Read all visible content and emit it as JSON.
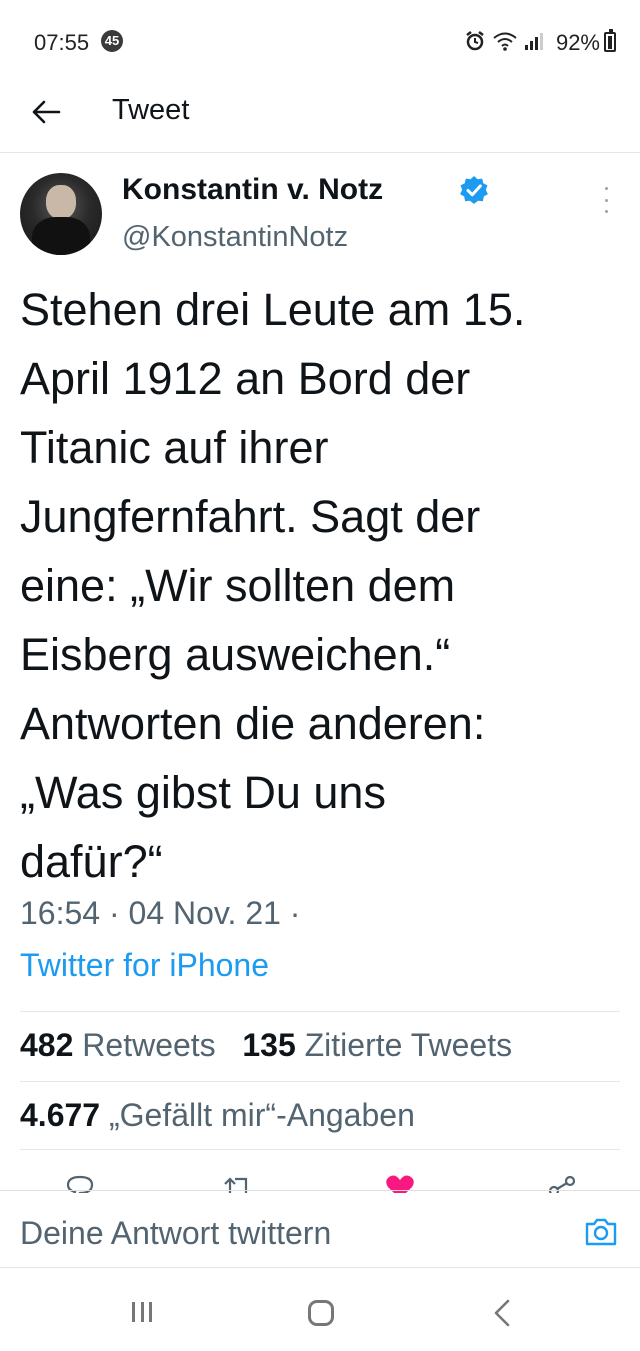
{
  "status_bar": {
    "time": "07:55",
    "notification_count": "45",
    "battery": "92%"
  },
  "header": {
    "title": "Tweet"
  },
  "tweet": {
    "author_name": "Konstantin v. Notz",
    "author_handle": "@KonstantinNotz",
    "text": "Stehen drei Leute am 15.\nApril 1912 an Bord der\nTitanic auf ihrer\nJungfernfahrt. Sagt der\neine: „Wir sollten dem\nEisberg ausweichen.“\nAntworten die anderen:\n„Was gibst Du uns\ndafür?“",
    "meta": "16:54 · 04 Nov. 21 ·",
    "source": "Twitter for iPhone",
    "retweets_count": "482",
    "retweets_label": "Retweets",
    "quotes_count": "135",
    "quotes_label": "Zitierte Tweets",
    "likes_count": "4.677",
    "likes_label": "„Gefällt mir“-Angaben"
  },
  "reply": {
    "placeholder": "Deine Antwort twittern"
  },
  "colors": {
    "accent": "#1d9bf0",
    "like": "#f91880",
    "secondary_text": "#536471",
    "primary_text": "#0f1419"
  },
  "icons": [
    "back-arrow-icon",
    "verified-badge-icon",
    "more-options-icon",
    "reply-icon",
    "retweet-icon",
    "like-heart-icon",
    "share-icon",
    "camera-icon",
    "wifi-icon",
    "signal-icon",
    "alarm-icon",
    "battery-icon"
  ]
}
